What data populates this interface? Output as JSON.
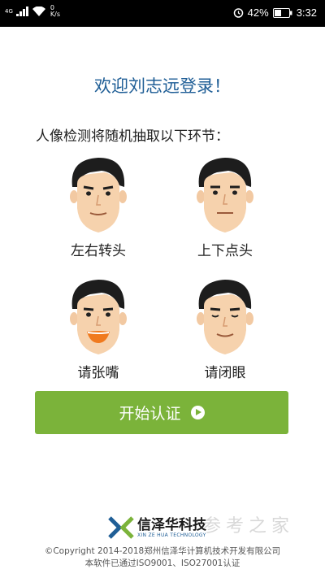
{
  "status_bar": {
    "signal_label": "4G",
    "net_speed_value": "0",
    "net_speed_unit": "K/s",
    "battery": "42%",
    "time": "3:32"
  },
  "welcome": "欢迎刘志远登录！",
  "intro": "人像检测将随机抽取以下环节：",
  "actions": [
    {
      "label": "左右转头"
    },
    {
      "label": "上下点头"
    },
    {
      "label": "请张嘴"
    },
    {
      "label": "请闭眼"
    }
  ],
  "start_button": "开始认证",
  "brand": {
    "name": "信泽华科技",
    "english": "XIN ZE HUA TECHNOLOGY"
  },
  "copyright_line1": "©Copyright 2014-2018郑州信泽华计算机技术开发有限公司",
  "copyright_line2": "本软件已通过ISO9001、ISO27001认证",
  "watermark": "参考之家",
  "colors": {
    "accent_blue": "#1f5e96",
    "button_green": "#7bb33a"
  }
}
